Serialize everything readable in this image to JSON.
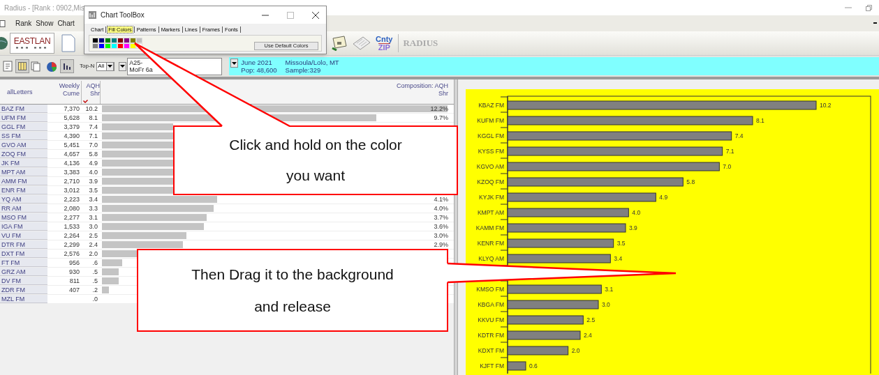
{
  "title_bar": {
    "title": "Radius - [Rank : 0902,Mis"
  },
  "menu": [
    {
      "label": "Rank"
    },
    {
      "label": "Show"
    },
    {
      "label": "Chart"
    }
  ],
  "toolbar": {
    "logo_text": "EASTLAN",
    "cnty": "Cnty",
    "zip": "ZIP",
    "brand": "RADIUS"
  },
  "selectors": {
    "topn_label": "Top-N",
    "topn_value": "All",
    "demo": [
      "A25-",
      "MoFr 6a"
    ],
    "market": {
      "month": "June 2021",
      "name": "Missoula/Lolo, MT",
      "pop": "Pop: 48,600",
      "sample": "Sample:329"
    }
  },
  "table": {
    "columns": [
      {
        "label": "allLetters",
        "sorted": false
      },
      {
        "label": "Weekly Cume",
        "sorted": false
      },
      {
        "label": "AQH Shr",
        "sorted": true
      },
      {
        "label": "Composition: AQH Shr",
        "sorted": false
      }
    ],
    "rows": [
      {
        "call": "BAZ FM",
        "cume": "7,370",
        "shr": "10.2",
        "composition": "12.2%"
      },
      {
        "call": "UFM FM",
        "cume": "5,628",
        "shr": "8.1",
        "composition": "9.7%"
      },
      {
        "call": "GGL FM",
        "cume": "3,379",
        "shr": "7.4"
      },
      {
        "call": "SS FM",
        "cume": "4,390",
        "shr": "7.1"
      },
      {
        "call": "GVO AM",
        "cume": "5,451",
        "shr": "7.0"
      },
      {
        "call": "ZOQ FM",
        "cume": "4,657",
        "shr": "5.8"
      },
      {
        "call": "JK FM",
        "cume": "4,136",
        "shr": "4.9"
      },
      {
        "call": "MPT AM",
        "cume": "3,383",
        "shr": "4.0"
      },
      {
        "call": "AMM FM",
        "cume": "2,710",
        "shr": "3.9"
      },
      {
        "call": "ENR FM",
        "cume": "3,012",
        "shr": "3.5"
      },
      {
        "call": "YQ AM",
        "cume": "2,223",
        "shr": "3.4",
        "composition": "4.1%"
      },
      {
        "call": "RR AM",
        "cume": "2,080",
        "shr": "3.3",
        "composition": "4.0%"
      },
      {
        "call": "MSO FM",
        "cume": "2,277",
        "shr": "3.1",
        "composition": "3.7%"
      },
      {
        "call": "IGA FM",
        "cume": "1,533",
        "shr": "3.0",
        "composition": "3.6%"
      },
      {
        "call": "VU FM",
        "cume": "2,264",
        "shr": "2.5",
        "composition": "3.0%"
      },
      {
        "call": "DTR FM",
        "cume": "2,299",
        "shr": "2.4",
        "composition": "2.9%"
      },
      {
        "call": "DXT FM",
        "cume": "2,576",
        "shr": "2.0"
      },
      {
        "call": "FT FM",
        "cume": "956",
        "shr": ".6"
      },
      {
        "call": "GRZ AM",
        "cume": "930",
        "shr": ".5"
      },
      {
        "call": "DV FM",
        "cume": "811",
        "shr": ".5"
      },
      {
        "call": "ZDR FM",
        "cume": "407",
        "shr": ".2"
      },
      {
        "call": "MZL FM",
        "shr": ".0"
      }
    ]
  },
  "chart": {
    "chart_data": {
      "type": "bar",
      "orientation": "horizontal",
      "categories": [
        "KBAZ FM",
        "KUFM FM",
        "KGGL FM",
        "KYSS FM",
        "KGVO AM",
        "KZOQ FM",
        "KYJK FM",
        "KMPT AM",
        "KAMM FM",
        "KENR FM",
        "KLYQ AM",
        null,
        "KMSO FM",
        "KBGA FM",
        "KKVU FM",
        "KDTR FM",
        "KDXT FM",
        "KJFT FM"
      ],
      "values": [
        10.2,
        8.1,
        7.4,
        7.1,
        7.0,
        5.8,
        4.9,
        4.0,
        3.9,
        3.5,
        3.4,
        null,
        3.1,
        3.0,
        2.5,
        2.4,
        2.0,
        0.6
      ],
      "value_labels": [
        "10.2",
        "8.1",
        "7.4",
        "7.1",
        "7.0",
        "5.8",
        "4.9",
        "4.0",
        "3.9",
        "3.5",
        "3.4",
        null,
        "3.1",
        "3.0",
        "2.5",
        "2.4",
        "2.0",
        "0.6"
      ],
      "xlim": [
        0,
        12
      ]
    }
  },
  "toolbox": {
    "title": "Chart ToolBox",
    "tabs": [
      {
        "label": "Chart",
        "selected": false
      },
      {
        "label": "Fill Colors",
        "selected": true
      },
      {
        "label": "Patterns",
        "selected": false
      },
      {
        "label": "Markers",
        "selected": false
      },
      {
        "label": "Lines",
        "selected": false
      },
      {
        "label": "Frames",
        "selected": false
      },
      {
        "label": "Fonts",
        "selected": false
      }
    ],
    "palette": [
      {
        "color": "#000000"
      },
      {
        "color": "#000080"
      },
      {
        "color": "#008000"
      },
      {
        "color": "#008080"
      },
      {
        "color": "#800000"
      },
      {
        "color": "#800080"
      },
      {
        "color": "#808000"
      },
      {
        "color": "#c0c0c0"
      },
      {
        "color": "#808080"
      },
      {
        "color": "#0000ff"
      },
      {
        "color": "#00ff00"
      },
      {
        "color": "#00ffff"
      },
      {
        "color": "#ff0000"
      },
      {
        "color": "#ff00ff"
      },
      {
        "color": "#ffff00"
      },
      {
        "color": "#ffffff"
      }
    ],
    "default_button": "Use Default Colors"
  },
  "callouts": [
    {
      "text": "Click and hold on the color you want"
    },
    {
      "text": "Then Drag it to the background and release"
    }
  ]
}
